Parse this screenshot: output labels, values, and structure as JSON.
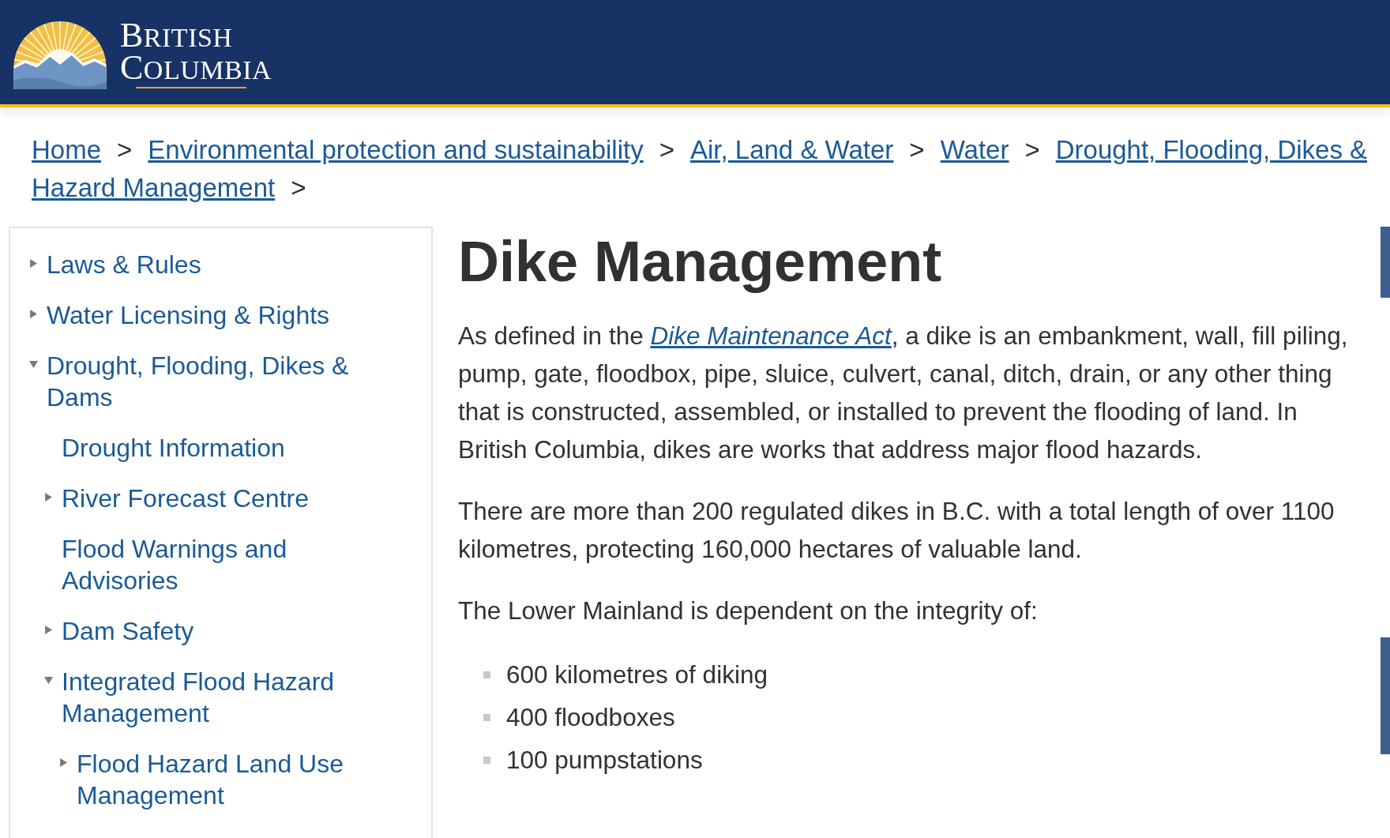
{
  "header": {
    "logo_line_1": "BRITISH",
    "logo_line_2": "COLUMBIA"
  },
  "breadcrumb": [
    {
      "label": "Home",
      "separator": ">"
    },
    {
      "label": "Environmental protection and sustainability",
      "separator": ">"
    },
    {
      "label": "Air, Land & Water",
      "separator": ">"
    },
    {
      "label": "Water",
      "separator": ">"
    },
    {
      "label": "Drought, Flooding, Dikes &"
    },
    {
      "label": "Hazard Management",
      "separator": ">"
    }
  ],
  "sidebar": {
    "items": [
      {
        "label": "Laws & Rules",
        "kind": "branch",
        "expanded": false
      },
      {
        "label": "Water Licensing & Rights",
        "kind": "branch",
        "expanded": false
      },
      {
        "label": "Drought, Flooding, Dikes & Dams",
        "kind": "branch",
        "expanded": true,
        "children": [
          {
            "label": "Drought Information",
            "kind": "leaf",
            "expanded": false
          },
          {
            "label": "River Forecast Centre",
            "kind": "branch",
            "expanded": false
          },
          {
            "label": "Flood Warnings and Advisories",
            "kind": "leaf",
            "expanded": false
          },
          {
            "label": "Dam Safety",
            "kind": "branch",
            "expanded": false
          },
          {
            "label": "Integrated Flood Hazard Management",
            "kind": "branch",
            "expanded": true,
            "children": [
              {
                "label": "Flood Hazard Land Use Management",
                "kind": "branch",
                "expanded": false
              }
            ]
          }
        ]
      }
    ]
  },
  "article": {
    "title": "Dike Management",
    "paragraph_1": {
      "before": "As defined in the ",
      "link": "Dike Maintenance Act",
      "after": ", a dike is an embankment, wall, fill piling, pump, gate, floodbox, pipe, sluice, culvert, canal, ditch, drain, or any other thing that is constructed, assembled, or installed to prevent the flooding of land. In British Columbia, dikes are works that address major flood hazards."
    },
    "paragraph_2": "There are more than 200 regulated dikes in B.C. with a total length of over 1100 kilometres, protecting 160,000 hectares of valuable land.",
    "paragraph_3": "The Lower Mainland is dependent on the integrity of:",
    "list": [
      "600 kilometres of diking",
      "400 floodboxes",
      "100 pumpstations"
    ]
  }
}
